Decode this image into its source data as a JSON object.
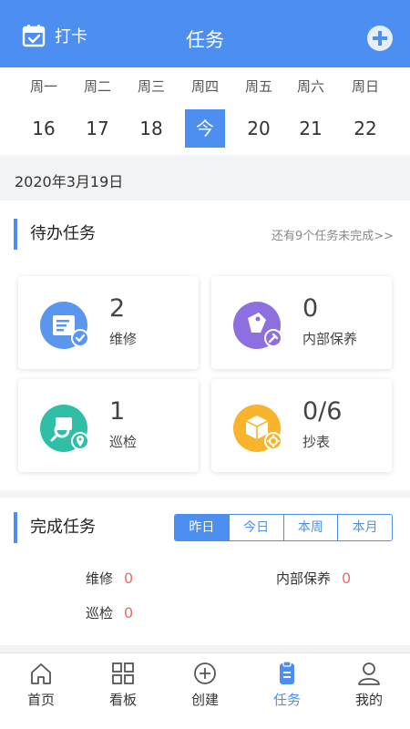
{
  "header": {
    "checkin_label": "打卡",
    "title": "任务"
  },
  "week": {
    "days": [
      "周一",
      "周二",
      "周三",
      "周四",
      "周五",
      "周六",
      "周日"
    ],
    "dates": [
      "16",
      "17",
      "18",
      "今",
      "20",
      "21",
      "22"
    ],
    "selected_index": 3
  },
  "current_date": "2020年3月19日",
  "pending": {
    "title": "待办任务",
    "more_link": "还有9个任务未完成>>",
    "cards": [
      {
        "count": "2",
        "label": "维修",
        "icon": "repair-doc-icon",
        "color": "#5b96ee"
      },
      {
        "count": "0",
        "label": "内部保养",
        "icon": "maintenance-tag-icon",
        "color": "#8e6fe0"
      },
      {
        "count": "1",
        "label": "巡检",
        "icon": "inspection-search-icon",
        "color": "#2fbfa7"
      },
      {
        "count": "0/6",
        "label": "抄表",
        "icon": "meter-box-icon",
        "color": "#f7b42c"
      }
    ]
  },
  "done": {
    "title": "完成任务",
    "tabs": [
      "昨日",
      "今日",
      "本周",
      "本月"
    ],
    "active_tab": 0,
    "stats": [
      {
        "label": "维修",
        "value": "0"
      },
      {
        "label": "内部保养",
        "value": "0"
      },
      {
        "label": "巡检",
        "value": "0"
      }
    ]
  },
  "tabbar": {
    "items": [
      {
        "label": "首页",
        "icon": "home-icon"
      },
      {
        "label": "看板",
        "icon": "dashboard-grid-icon"
      },
      {
        "label": "创建",
        "icon": "create-plus-icon"
      },
      {
        "label": "任务",
        "icon": "task-clipboard-icon"
      },
      {
        "label": "我的",
        "icon": "profile-icon"
      }
    ],
    "active_index": 3
  },
  "colors": {
    "accent": "#4d8ff0",
    "zero_value": "#f06a6a"
  }
}
